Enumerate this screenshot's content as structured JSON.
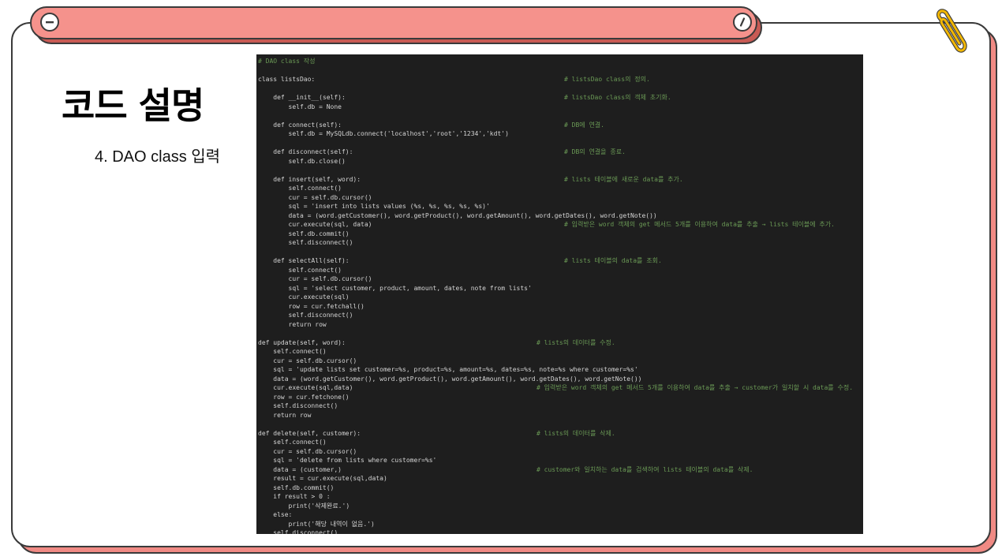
{
  "slide": {
    "title": "코드 설명",
    "subtitle": "4. DAO class 입력",
    "tab_left_icon": "minus-circle-icon",
    "tab_right_icon": "slash-circle-icon",
    "decoration_icon": "paperclip-icon",
    "colors": {
      "tab_fill": "#f5928c",
      "tab_shadow": "#c85a54",
      "card_shadow": "#f08a84",
      "border": "#3a3a3a",
      "code_bg": "#1e1e1e",
      "code_text": "#d4d4d4",
      "code_comment": "#6a9955",
      "clip": "#f2b705"
    }
  },
  "code": {
    "lines": [
      {
        "text": "# DAO class 작성",
        "comment": ""
      },
      {
        "text": "",
        "comment": ""
      },
      {
        "text": "class listsDao:",
        "comment": "# listsDao class의 정의."
      },
      {
        "text": "",
        "comment": ""
      },
      {
        "text": "    def __init__(self):",
        "comment": "# listsDao class의 객체 초기화."
      },
      {
        "text": "        self.db = None",
        "comment": ""
      },
      {
        "text": "",
        "comment": ""
      },
      {
        "text": "    def connect(self):",
        "comment": "# DB에 연결."
      },
      {
        "text": "        self.db = MySQLdb.connect('localhost','root','1234','kdt')",
        "comment": ""
      },
      {
        "text": "",
        "comment": ""
      },
      {
        "text": "    def disconnect(self):",
        "comment": "# DB의 연결을 종료."
      },
      {
        "text": "        self.db.close()",
        "comment": ""
      },
      {
        "text": "",
        "comment": ""
      },
      {
        "text": "    def insert(self, word):",
        "comment": "# lists 테이블에 새로운 data를 추가."
      },
      {
        "text": "        self.connect()",
        "comment": ""
      },
      {
        "text": "        cur = self.db.cursor()",
        "comment": ""
      },
      {
        "text": "        sql = 'insert into lists values (%s, %s, %s, %s, %s)'",
        "comment": ""
      },
      {
        "text": "        data = (word.getCustomer(), word.getProduct(), word.getAmount(), word.getDates(), word.getNote())",
        "comment": ""
      },
      {
        "text": "        cur.execute(sql, data)",
        "comment": "# 입력받은 word 객체의 get 메서드 5개를 이용하여 data를 추출 → lists 테이블에 추가."
      },
      {
        "text": "        self.db.commit()",
        "comment": ""
      },
      {
        "text": "        self.disconnect()",
        "comment": ""
      },
      {
        "text": "",
        "comment": ""
      },
      {
        "text": "    def selectAll(self):",
        "comment": "# lists 테이블의 data를 조회."
      },
      {
        "text": "        self.connect()",
        "comment": ""
      },
      {
        "text": "        cur = self.db.cursor()",
        "comment": ""
      },
      {
        "text": "        sql = 'select customer, product, amount, dates, note from lists'",
        "comment": ""
      },
      {
        "text": "        cur.execute(sql)",
        "comment": ""
      },
      {
        "text": "        row = cur.fetchall()",
        "comment": ""
      },
      {
        "text": "        self.disconnect()",
        "comment": ""
      },
      {
        "text": "        return row",
        "comment": ""
      },
      {
        "text": "",
        "comment": ""
      },
      {
        "text": "def update(self, word):",
        "comment": "# lists의 데이터를 수정."
      },
      {
        "text": "    self.connect()",
        "comment": ""
      },
      {
        "text": "    cur = self.db.cursor()",
        "comment": ""
      },
      {
        "text": "    sql = 'update lists set customer=%s, product=%s, amount=%s, dates=%s, note=%s where customer=%s'",
        "comment": ""
      },
      {
        "text": "    data = (word.getCustomer(), word.getProduct(), word.getAmount(), word.getDates(), word.getNote())",
        "comment": ""
      },
      {
        "text": "    cur.execute(sql,data)",
        "comment": "# 입력받은 word 객체의 get 메서드 5개를 이용하여 data를 추출 → customer가 일치할 시 data를 수정."
      },
      {
        "text": "    row = cur.fetchone()",
        "comment": ""
      },
      {
        "text": "    self.disconnect()",
        "comment": ""
      },
      {
        "text": "    return row",
        "comment": ""
      },
      {
        "text": "",
        "comment": ""
      },
      {
        "text": "def delete(self, customer):",
        "comment": "# lists의 데이터를 삭제."
      },
      {
        "text": "    self.connect()",
        "comment": ""
      },
      {
        "text": "    cur = self.db.cursor()",
        "comment": ""
      },
      {
        "text": "    sql = 'delete from lists where customer=%s'",
        "comment": ""
      },
      {
        "text": "    data = (customer,)",
        "comment": "# customer와 일치하는 data를 검색하여 lists 테이블의 data를 삭제."
      },
      {
        "text": "    result = cur.execute(sql,data)",
        "comment": ""
      },
      {
        "text": "    self.db.commit()",
        "comment": ""
      },
      {
        "text": "    if result > 0 :",
        "comment": ""
      },
      {
        "text": "        print('삭제완료.')",
        "comment": ""
      },
      {
        "text": "    else:",
        "comment": ""
      },
      {
        "text": "        print('해당 내역이 없음.')",
        "comment": ""
      },
      {
        "text": "    self.disconnect()",
        "comment": ""
      }
    ]
  }
}
